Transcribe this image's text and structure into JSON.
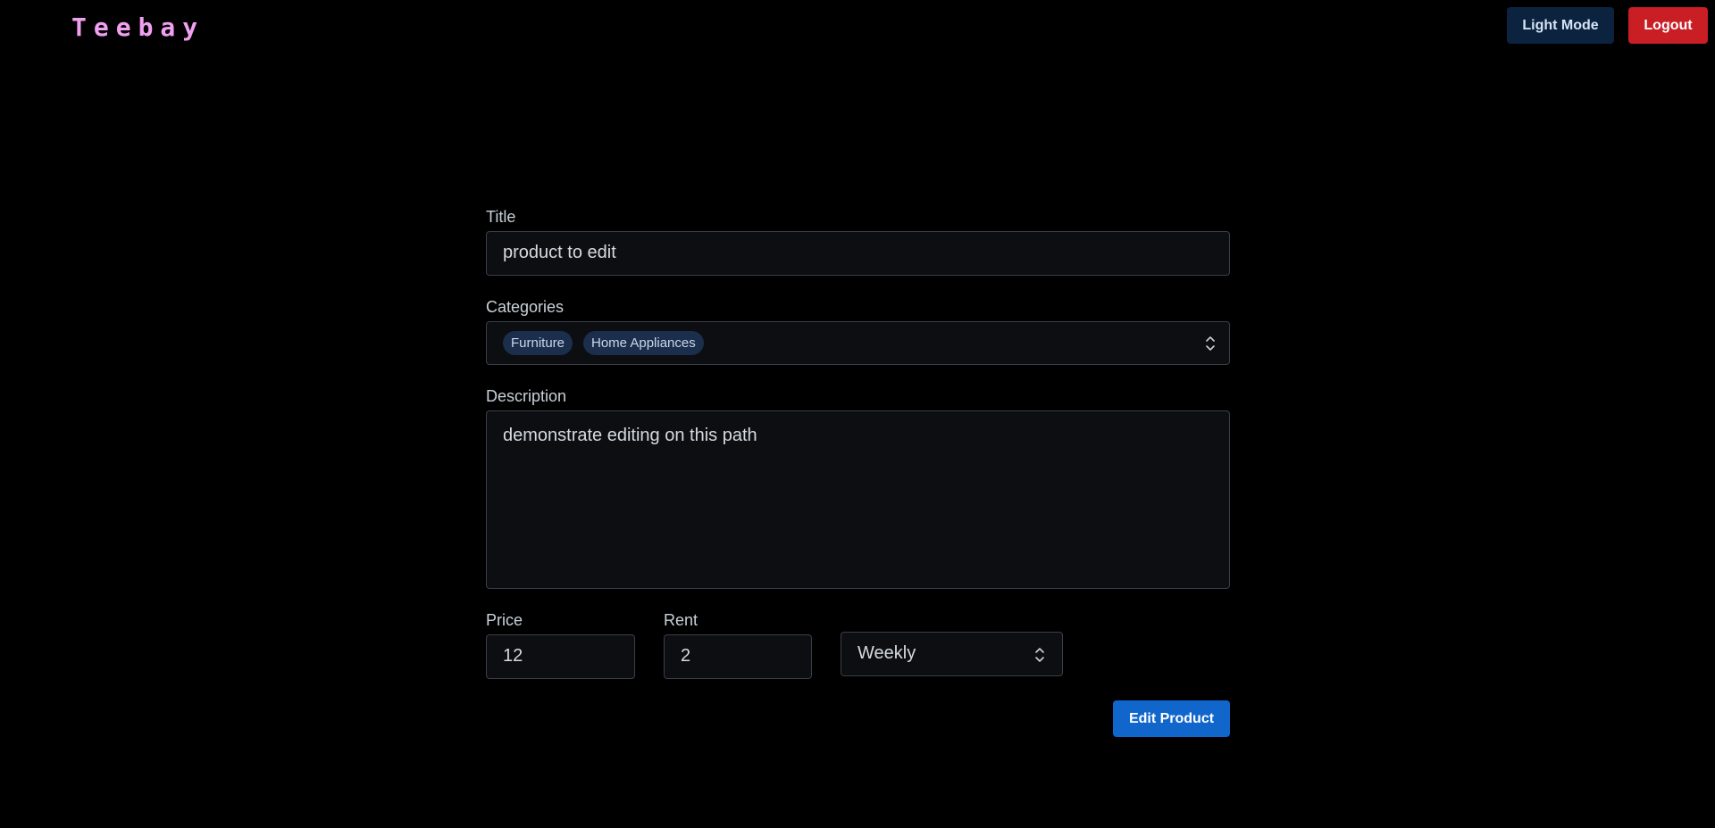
{
  "app": {
    "brand": "Teebay"
  },
  "header": {
    "theme_toggle_label": "Light Mode",
    "logout_label": "Logout"
  },
  "form": {
    "title_label": "Title",
    "title_value": "product to edit",
    "categories_label": "Categories",
    "categories_selected": [
      "Furniture",
      "Home Appliances"
    ],
    "description_label": "Description",
    "description_value": "demonstrate editing on this path",
    "price_label": "Price",
    "price_value": "12",
    "rent_label": "Rent",
    "rent_value": "2",
    "rent_period": "Weekly",
    "submit_label": "Edit Product"
  },
  "icons": {
    "select_indicator": "chevron-up-down-icon"
  },
  "colors": {
    "background": "#000000",
    "brand": "#f0a0f0",
    "theme_button": "#0c2340",
    "logout_button": "#c81e24",
    "submit_button": "#1166cc",
    "chip": "#1b2f4d"
  }
}
